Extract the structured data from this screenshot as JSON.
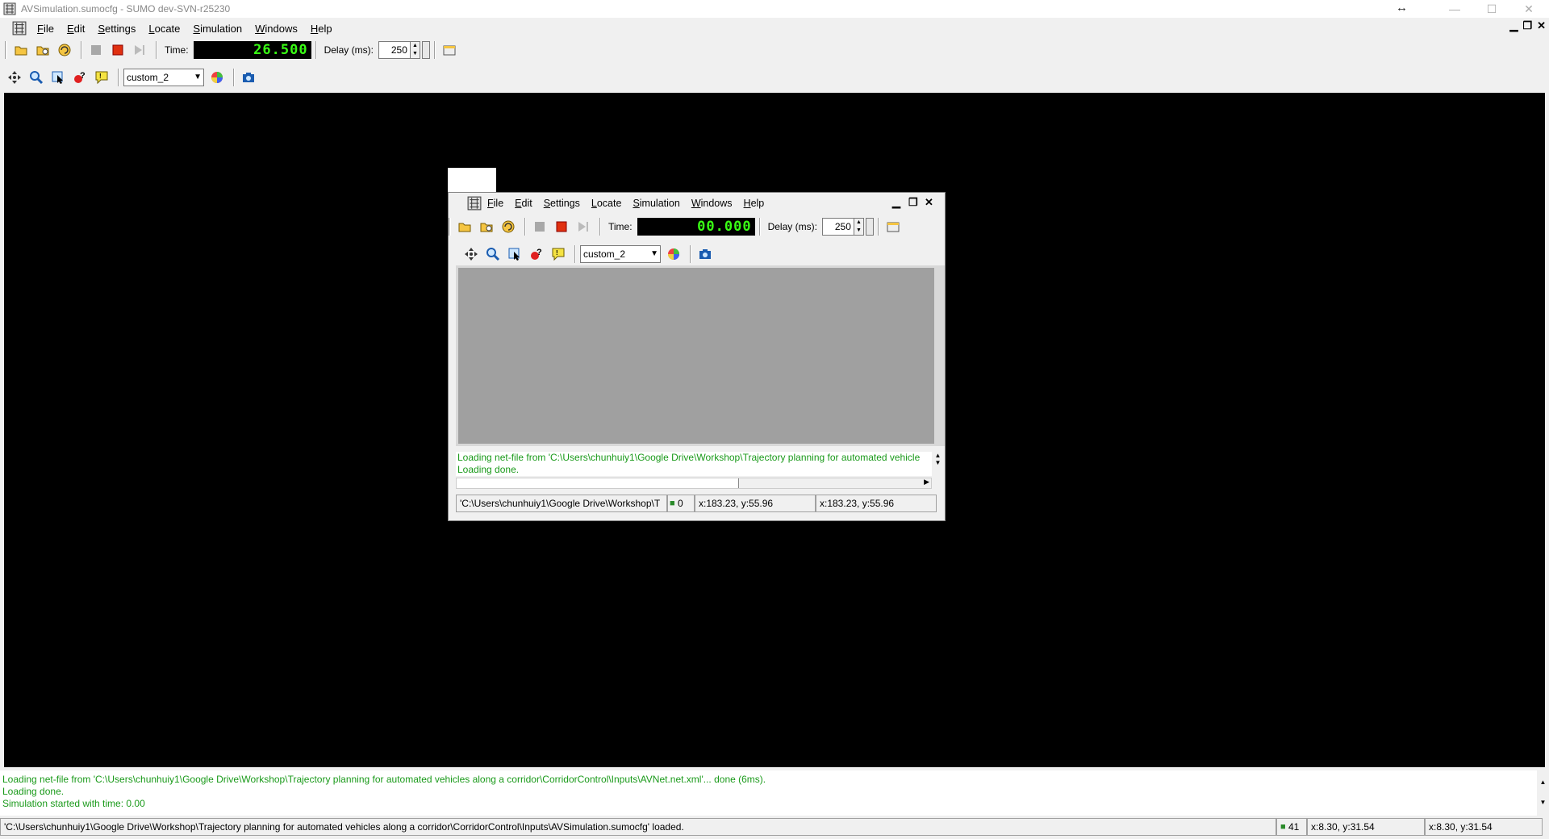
{
  "window": {
    "title": "AVSimulation.sumocfg - SUMO dev-SVN-r25230",
    "controls": [
      "—",
      "☐",
      "✕"
    ],
    "resize_glyph": "↔"
  },
  "menu": {
    "items": [
      {
        "key": "F",
        "rest": "ile"
      },
      {
        "key": "E",
        "rest": "dit"
      },
      {
        "key": "S",
        "rest": "ettings"
      },
      {
        "key": "L",
        "rest": "ocate"
      },
      {
        "key": "S",
        "rest": "imulation"
      },
      {
        "key": "W",
        "rest": "indows"
      },
      {
        "key": "H",
        "rest": "elp"
      }
    ],
    "labels": [
      "File",
      "Edit",
      "Settings",
      "Locate",
      "Simulation",
      "Windows",
      "Help"
    ]
  },
  "toolbar": {
    "time_label": "Time:",
    "time_value": "26.500",
    "delay_label": "Delay (ms):",
    "delay_value": "250",
    "scheme": "custom_2"
  },
  "log": {
    "lines": [
      "Loading net-file from 'C:\\Users\\chunhuiy1\\Google Drive\\Workshop\\Trajectory planning for automated vehicles along a corridor\\CorridorControl\\Inputs\\AVNet.net.xml'... done (6ms).",
      "Loading done.",
      "Simulation started with time: 0.00"
    ]
  },
  "status": {
    "message": "'C:\\Users\\chunhuiy1\\Google Drive\\Workshop\\Trajectory planning for automated vehicles along a corridor\\CorridorControl\\Inputs\\AVSimulation.sumocfg' loaded.",
    "vehicle_count": "41",
    "coord1": "x:8.30, y:31.54",
    "coord2": "x:8.30, y:31.54"
  },
  "inner": {
    "time_label": "Time:",
    "time_value": "00.000",
    "delay_label": "Delay (ms):",
    "delay_value": "250",
    "scheme": "custom_2",
    "log": [
      "Loading net-file from 'C:\\Users\\chunhuiy1\\Google Drive\\Workshop\\Trajectory planning for automated vehicle",
      "Loading done."
    ],
    "status_message": "'C:\\Users\\chunhuiy1\\Google Drive\\Workshop\\T",
    "vehicle_count": "0",
    "coord1": "x:183.23, y:55.96",
    "coord2": "x:183.23, y:55.96"
  },
  "colors": {
    "lcd_text": "#39ff14",
    "log_text": "#1a9a1a",
    "canvas_main": "#000000",
    "canvas_inner": "#a0a0a0"
  }
}
